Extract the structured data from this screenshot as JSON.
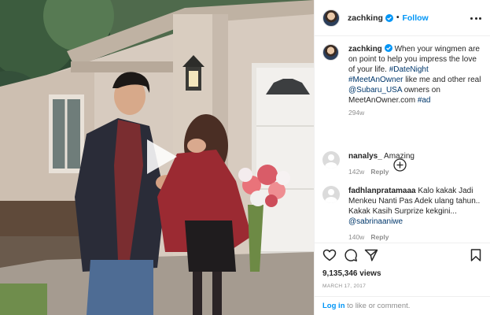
{
  "header": {
    "username": "zachking",
    "separator": "•",
    "follow_label": "Follow",
    "more_icon": "more-horizontal-icon"
  },
  "caption": {
    "username": "zachking",
    "text_1": " When your wingmen are on point to help you impress the love of your life. ",
    "tag_1": "#DateNight",
    "text_2": " ",
    "tag_2": "#MeetAnOwner",
    "text_3": " like me and other real ",
    "mention_1": "@Subaru_USA",
    "text_4": " owners on MeetAnOwner.com ",
    "tag_3": "#ad",
    "time": "294w"
  },
  "load_more_icon": "plus-circle-icon",
  "comments": [
    {
      "username": "nanalys_",
      "text": " Amazing",
      "time": "142w",
      "reply_label": "Reply"
    },
    {
      "username": "fadhlanpratamaaa",
      "text": " Kalo kakak Jadi Menkeu Nanti Pas Adek ulang tahun.. Kakak Kasih Surprize kekgini... ",
      "mention": "@sabrinaaniwe",
      "time": "140w",
      "reply_label": "Reply"
    }
  ],
  "actions": {
    "icons": [
      "heart-icon",
      "comment-icon",
      "share-icon",
      "bookmark-icon"
    ]
  },
  "views": "9,135,346 views",
  "date": "MARCH 17, 2017",
  "login": {
    "link_label": "Log in",
    "rest": " to like or comment."
  },
  "colors": {
    "accent": "#0095f6",
    "link": "#00376b",
    "muted": "#8e8e8e",
    "text": "#262626",
    "border": "#efefef"
  }
}
